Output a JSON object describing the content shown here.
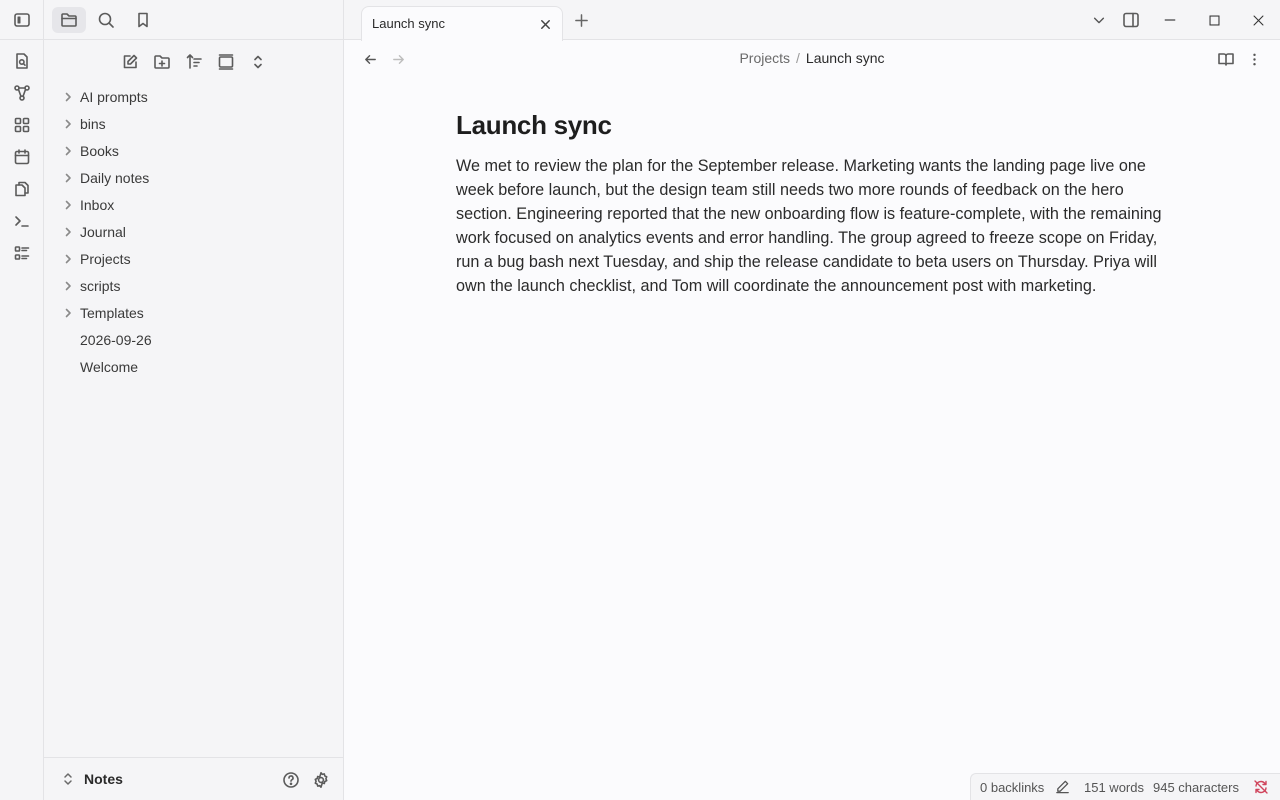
{
  "sidebar": {
    "tree": [
      {
        "label": "AI prompts",
        "folder": true
      },
      {
        "label": "bins",
        "folder": true
      },
      {
        "label": "Books",
        "folder": true
      },
      {
        "label": "Daily notes",
        "folder": true
      },
      {
        "label": "Inbox",
        "folder": true
      },
      {
        "label": "Journal",
        "folder": true
      },
      {
        "label": "Projects",
        "folder": true
      },
      {
        "label": "scripts",
        "folder": true
      },
      {
        "label": "Templates",
        "folder": true
      },
      {
        "label": "2026-09-26",
        "folder": false
      },
      {
        "label": "Welcome",
        "folder": false
      }
    ],
    "vault_name": "Notes"
  },
  "tabs": [
    {
      "title": "Launch sync",
      "active": true
    }
  ],
  "breadcrumb": {
    "parent": "Projects",
    "separator": "/",
    "current": "Launch sync"
  },
  "note": {
    "title": "Launch sync",
    "body": "We met to review the plan for the September release. Marketing wants the landing page live one week before launch, but the design team still needs two more rounds of feedback on the hero section. Engineering reported that the new onboarding flow is feature-complete, with the remaining work focused on analytics events and error handling. The group agreed to freeze scope on Friday, run a bug bash next Tuesday, and ship the release candidate to beta users on Thursday. Priya will own the launch checklist, and Tom will coordinate the announcement post with marketing."
  },
  "status": {
    "backlinks": "0 backlinks",
    "words": "151 words",
    "characters": "945 characters"
  },
  "colors": {
    "background": "#fbfbfd",
    "sidebar": "#f5f5f7",
    "sync_error": "#d0445c"
  }
}
